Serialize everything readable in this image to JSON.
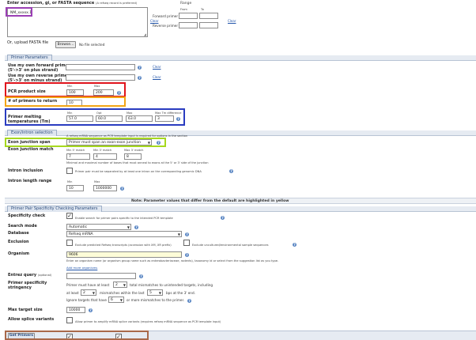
{
  "header": {
    "title": "Enter accession, gi, or FASTA sequence",
    "subtitle": "(A refseq record is preferred)",
    "textarea_value": "NM_xxxxx.1",
    "clear_label": "Clear",
    "range_label": "Range",
    "from_label": "From",
    "to_label": "To",
    "forward_primer_label": "Forward primer",
    "reverse_primer_label": "Reverse primer",
    "upload_label": "Or, upload FASTA file",
    "browse_label": "Browse...",
    "file_status": "No file selected"
  },
  "primer_params": {
    "tab_label": "Primer Parameters",
    "use_forward_label": "Use my own forward primer",
    "use_forward_sub": "(5'->3' on plus strand)",
    "use_reverse_label": "Use my own reverse primer",
    "use_reverse_sub": "(5'->3' on minus strand)",
    "clear_label": "Clear",
    "product_size_label": "PCR product size",
    "min_label": "Min",
    "max_label": "Max",
    "opt_label": "Opt",
    "max_tm_diff_label": "Max Tm difference",
    "product_min": "100",
    "product_max": "200",
    "num_return_label": "# of primers to return",
    "num_return": "10",
    "tm_label": "Primer melting temperatures (Tm)",
    "tm_min": "57.0",
    "tm_opt": "60.0",
    "tm_max": "63.0",
    "tm_diff": "3"
  },
  "exon": {
    "tab_label": "Exon/intron selection",
    "note": "A refseq mRNA sequence as PCR template input is required for options in the section",
    "junction_span_label": "Exon junction span",
    "junction_span_value": "Primer must span an exon-exon junction",
    "junction_match_label": "Exon junction match",
    "match_5_label": "Min 5' match",
    "match_3_label": "Min 3' match",
    "match_3max_label": "Max 3' match",
    "match_5": "7",
    "match_3": "4",
    "match_3max": "8",
    "match_note": "Minimal and maximal number of bases that must anneal to exons at the 5' or 3' side of the junction",
    "intron_inclusion_label": "Intron inclusion",
    "intron_inclusion_note": "Primer pair must be separated by at least one intron on the corresponding genomic DNA",
    "intron_range_label": "Intron length range",
    "intron_min": "10",
    "intron_max": "1000000"
  },
  "note_bar": "Note: Parameter values that differ from the default are highlighted in yellow",
  "specificity": {
    "tab_label": "Primer Pair Specificity Checking Parameters",
    "check_label": "Specificity check",
    "check_note": "Enable search for primer pairs specific to the intended PCR template",
    "search_mode_label": "Search mode",
    "search_mode_value": "Automatic",
    "database_label": "Database",
    "database_value": "Refseq mRNA",
    "exclusion_label": "Exclusion",
    "exclusion_note_1": "Exclude predicted Refseq transcripts (accession with XM, XR prefix)",
    "exclusion_note_2": "Exclude uncultured/environmental sample sequences",
    "organism_label": "Organism",
    "organism_value": "9606",
    "organism_note": "Enter an organism name (or organism group name such as enterobacteriaceae, rodents), taxonomy id or select from the suggestion list as you type.",
    "add_more_label": "Add more organisms",
    "entrez_label": "Entrez query",
    "entrez_optional": "(optional)",
    "stringency_label": "Primer specificity stringency",
    "stringency_line1_a": "Primer must have at least",
    "stringency_line1_val": "2",
    "stringency_line1_b": "total mismatches to unintended targets, including",
    "stringency_line2_a": "at least",
    "stringency_line2_val": "2",
    "stringency_line2_b": "mismatches within the last",
    "stringency_line2_val2": "5",
    "stringency_line2_c": "bps at the 3' end.",
    "stringency_line3_a": "Ignore targets that have",
    "stringency_line3_val": "6",
    "stringency_line3_b": "or more mismatches to the primer.",
    "max_target_label": "Max target size",
    "max_target_value": "10000",
    "splice_label": "Allow splice variants",
    "splice_note": "Allow primer to amplify mRNA splice variants (requires refseq mRNA sequence as PCR template input)"
  },
  "footer": {
    "get_primers_label": "Get Primers"
  },
  "colors": {
    "purple": "#9b3fb5",
    "red": "#e0141c",
    "orange": "#f2a516",
    "blue": "#2a3cc0",
    "lime": "#a6d81e",
    "brown": "#a9694a"
  }
}
